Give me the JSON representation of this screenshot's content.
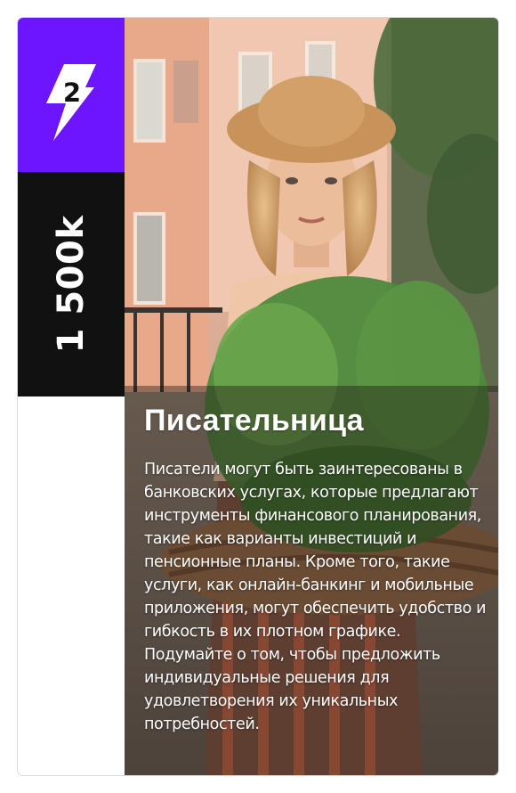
{
  "card": {
    "level": "2",
    "price": "1 500k",
    "title": "Писательница",
    "description": "Писатели могут быть заинтересованы в банковских услугах, которые предлагают инструменты финансового планирования, такие как варианты инвестиций и пенсионные планы. Кроме того, такие услуги, как онлайн-банкинг и мобильные приложения, могут обеспечить удобство и гибкость в их плотном графике. Подумайте о том, чтобы предложить индивидуальные решения для удовлетворения их уникальных потребностей."
  },
  "colors": {
    "accent": "#6e15ff",
    "price_block": "#111111",
    "text_light": "#ffffff"
  },
  "icons": {
    "level_icon": "lightning-bolt-icon"
  }
}
